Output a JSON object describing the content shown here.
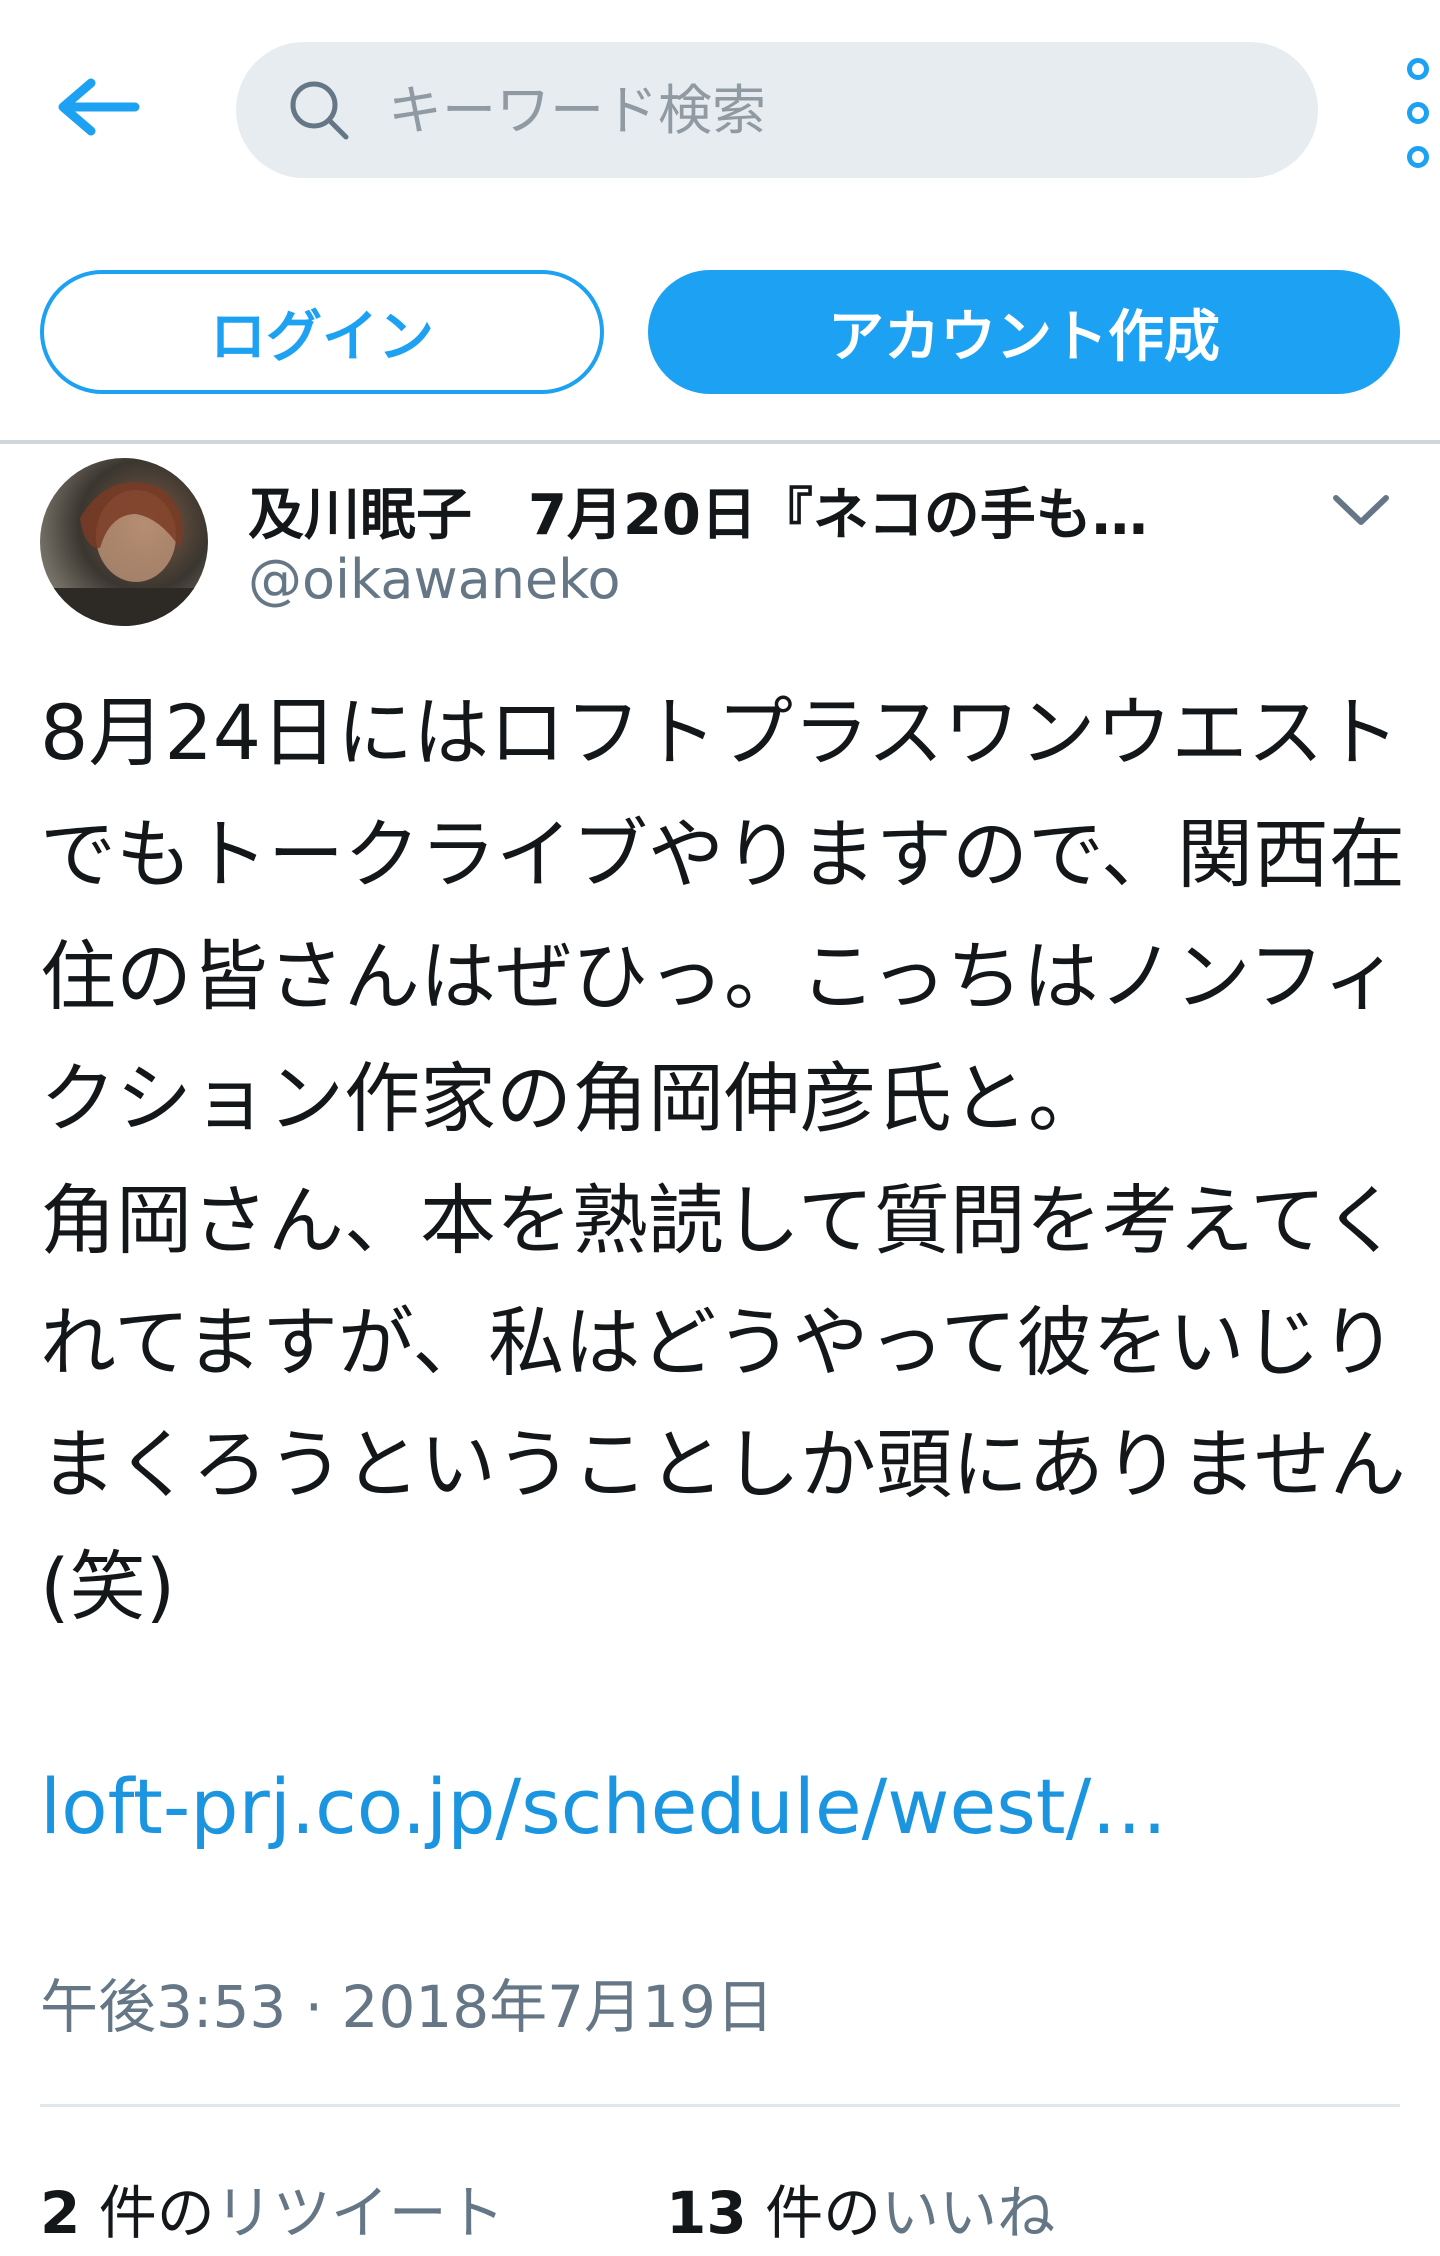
{
  "header": {
    "search_placeholder": "キーワード検索",
    "back_icon": "arrow-left-icon",
    "more_icon": "vertical-dots-icon"
  },
  "auth": {
    "login_label": "ログイン",
    "signup_label": "アカウント作成"
  },
  "tweet": {
    "display_name_line": "及川眠子　7月20日『ネコの手も…",
    "handle": "@oikawaneko",
    "body": "8月24日にはロフトプラスワンウエストでもトークライブやりますので、関西在住の皆さんはぜひっ。こっちはノンフィクション作家の角岡伸彦氏と。\n角岡さん、本を熟読して質問を考えてくれてますが、私はどうやって彼をいじりまくろうということしか頭にありません(笑)",
    "link": "loft-prj.co.jp/schedule/west/…",
    "timestamp": "午後3:53 · 2018年7月19日",
    "retweet_count": "2",
    "retweet_unit": " 件の",
    "retweet_label": "リツイート",
    "like_count": "13",
    "like_unit": " 件の",
    "like_label": "いいね"
  },
  "colors": {
    "accent": "#1da1f2",
    "link": "#1b95e0",
    "secondary_text": "#657786",
    "search_bg": "#e6ecf0"
  }
}
